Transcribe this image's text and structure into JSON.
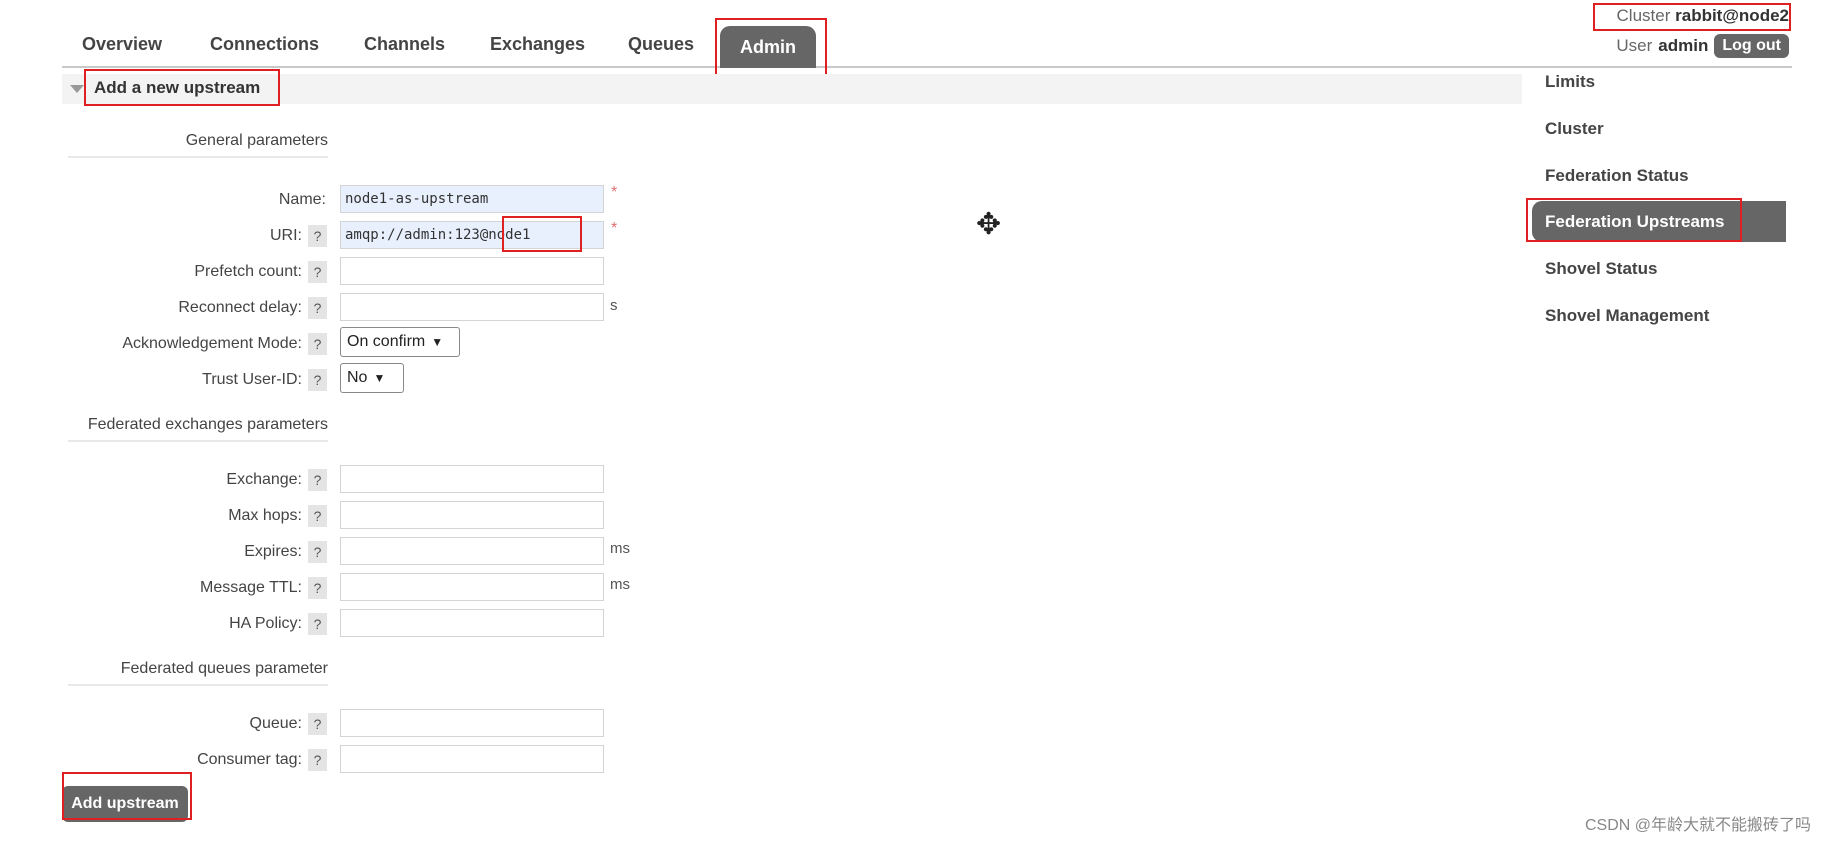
{
  "nav": {
    "tabs": [
      "Overview",
      "Connections",
      "Channels",
      "Exchanges",
      "Queues",
      "Admin"
    ],
    "active_tab": "Admin"
  },
  "header": {
    "cluster_label": "Cluster",
    "cluster_name": "rabbit@node2",
    "user_label": "User",
    "user_name": "admin",
    "logout_label": "Log out"
  },
  "section": {
    "title": "Add a new upstream"
  },
  "general": {
    "title": "General parameters",
    "name_label": "Name:",
    "name_value": "node1-as-upstream",
    "uri_label": "URI:",
    "uri_value": "amqp://admin:123@node1",
    "prefetch_label": "Prefetch count:",
    "reconnect_label": "Reconnect delay:",
    "reconnect_unit": "s",
    "ack_label": "Acknowledgement Mode:",
    "ack_value": "On confirm",
    "trust_label": "Trust User-ID:",
    "trust_value": "No",
    "required_mark": "*",
    "help_mark": "?"
  },
  "exchanges": {
    "title": "Federated exchanges parameters",
    "exchange_label": "Exchange:",
    "maxhops_label": "Max hops:",
    "expires_label": "Expires:",
    "expires_unit": "ms",
    "ttl_label": "Message TTL:",
    "ttl_unit": "ms",
    "ha_label": "HA Policy:"
  },
  "queues": {
    "title": "Federated queues parameter",
    "queue_label": "Queue:",
    "consumer_label": "Consumer tag:"
  },
  "add_button": "Add upstream",
  "sidebar": {
    "items": [
      "Limits",
      "Cluster",
      "Federation Status",
      "Federation Upstreams",
      "Shovel Status",
      "Shovel Management"
    ],
    "active": "Federation Upstreams"
  },
  "watermark": "CSDN @年龄大就不能搬砖了吗"
}
